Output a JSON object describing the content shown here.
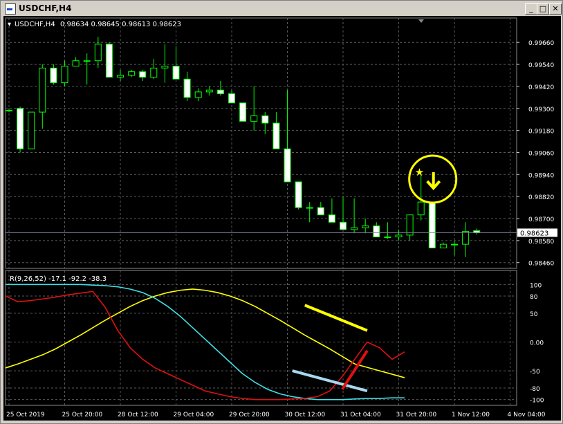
{
  "window": {
    "title": "USDCHF,H4",
    "icon": "chart-window-icon",
    "minimize_icon": "minimize-icon",
    "maximize_icon": "maximize-icon",
    "close_icon": "close-icon"
  },
  "colors": {
    "background": "#000000",
    "grid": "#5a5a5a",
    "axis_text": "#ffffff",
    "candle_stroke": "#00ff00",
    "bull_body": "#000000",
    "bear_body": "#ffffff",
    "price_line": "#7f7f9f",
    "yellow": "#ffff00",
    "cyan": "#40e0e8",
    "red": "#e01010",
    "light_blue": "#a8d8f0"
  },
  "chart_data": [
    {
      "type": "candlestick",
      "title": "USDCHF,H4",
      "ohlc_label": "0.98634 0.98645 0.98613 0.98623",
      "current_price": "0.98623",
      "yticks": [
        "0.99660",
        "0.99540",
        "0.99420",
        "0.99300",
        "0.99180",
        "0.99060",
        "0.98940",
        "0.98820",
        "0.98700",
        "0.98580",
        "0.98460"
      ],
      "ylim": [
        0.9844,
        0.9974
      ],
      "xticks": [
        {
          "i": 0,
          "label": "25 Oct 2019"
        },
        {
          "i": 5,
          "label": "25 Oct 20:00"
        },
        {
          "i": 10,
          "label": "28 Oct 12:00"
        },
        {
          "i": 15,
          "label": "29 Oct 04:00"
        },
        {
          "i": 20,
          "label": "29 Oct 20:00"
        },
        {
          "i": 25,
          "label": "30 Oct 12:00"
        },
        {
          "i": 30,
          "label": "31 Oct 04:00"
        },
        {
          "i": 35,
          "label": "31 Oct 20:00"
        },
        {
          "i": 40,
          "label": "1 Nov 12:00"
        },
        {
          "i": 45,
          "label": "4 Nov 04:00"
        }
      ],
      "candles": [
        [
          0.9929,
          0.993,
          0.9928,
          0.9929
        ],
        [
          0.993,
          0.9931,
          0.9906,
          0.9908
        ],
        [
          0.9908,
          0.9921,
          0.9908,
          0.9928
        ],
        [
          0.9928,
          0.9954,
          0.9919,
          0.9952
        ],
        [
          0.9952,
          0.9954,
          0.9943,
          0.9944
        ],
        [
          0.9944,
          0.9956,
          0.9942,
          0.9953
        ],
        [
          0.9953,
          0.9958,
          0.9953,
          0.9956
        ],
        [
          0.9956,
          0.996,
          0.9943,
          0.9956
        ],
        [
          0.9956,
          0.9969,
          0.9952,
          0.9965
        ],
        [
          0.9965,
          0.9966,
          0.9947,
          0.9947
        ],
        [
          0.9947,
          0.9951,
          0.9945,
          0.9948
        ],
        [
          0.9948,
          0.9951,
          0.9947,
          0.995
        ],
        [
          0.995,
          0.9951,
          0.9945,
          0.9947
        ],
        [
          0.9947,
          0.9957,
          0.9946,
          0.9952
        ],
        [
          0.9952,
          0.9965,
          0.9944,
          0.9953
        ],
        [
          0.9953,
          0.9964,
          0.9946,
          0.9946
        ],
        [
          0.9946,
          0.995,
          0.9934,
          0.9936
        ],
        [
          0.9936,
          0.9941,
          0.9934,
          0.9939
        ],
        [
          0.9939,
          0.9942,
          0.9937,
          0.994
        ],
        [
          0.994,
          0.9945,
          0.9937,
          0.9938
        ],
        [
          0.9938,
          0.994,
          0.9933,
          0.9933
        ],
        [
          0.9933,
          0.9933,
          0.9924,
          0.9923
        ],
        [
          0.9923,
          0.9942,
          0.9918,
          0.9926
        ],
        [
          0.9926,
          0.9928,
          0.9916,
          0.9922
        ],
        [
          0.9922,
          0.9928,
          0.9908,
          0.9908
        ],
        [
          0.9908,
          0.994,
          0.9892,
          0.989
        ],
        [
          0.989,
          0.989,
          0.9875,
          0.9876
        ],
        [
          0.9876,
          0.9879,
          0.9868,
          0.9876
        ],
        [
          0.9876,
          0.9879,
          0.9874,
          0.9872
        ],
        [
          0.9872,
          0.9881,
          0.9868,
          0.9868
        ],
        [
          0.9868,
          0.9882,
          0.9864,
          0.9864
        ],
        [
          0.9864,
          0.9881,
          0.9862,
          0.9865
        ],
        [
          0.9865,
          0.987,
          0.9862,
          0.9866
        ],
        [
          0.9866,
          0.9868,
          0.9861,
          0.986
        ],
        [
          0.986,
          0.9868,
          0.9859,
          0.986
        ],
        [
          0.986,
          0.9864,
          0.9858,
          0.9861
        ],
        [
          0.9861,
          0.9871,
          0.9858,
          0.9872
        ],
        [
          0.9872,
          0.9894,
          0.9869,
          0.9879
        ],
        [
          0.9879,
          0.9879,
          0.9854,
          0.9854
        ],
        [
          0.9854,
          0.9857,
          0.9854,
          0.9856
        ],
        [
          0.9856,
          0.9858,
          0.985,
          0.9856
        ],
        [
          0.9856,
          0.9868,
          0.9849,
          0.9863
        ],
        [
          0.98634,
          0.98645,
          0.98613,
          0.98623
        ]
      ],
      "annotation": {
        "type": "circle-with-star-and-arrow",
        "color": "#ffff00",
        "candle_index": 37
      }
    },
    {
      "type": "line",
      "indicator_label": "R(9,26,52) -17.1 -92.2 -38.3",
      "yticks": [
        "100",
        "80",
        "50",
        "0.00",
        "-50",
        "-80",
        "-100"
      ],
      "ylim": [
        -110,
        110
      ],
      "series": [
        {
          "color": "#ffff00",
          "values": [
            -45,
            -38,
            -30,
            -22,
            -12,
            0,
            12,
            25,
            38,
            50,
            62,
            72,
            80,
            86,
            90,
            92,
            90,
            86,
            80,
            72,
            62,
            50,
            38,
            25,
            12,
            0,
            -12,
            -25,
            -38,
            -44,
            -50,
            -56,
            -62
          ]
        },
        {
          "color": "#40e0e8",
          "values": [
            100,
            100,
            100,
            100,
            100,
            100,
            100,
            99,
            98,
            96,
            92,
            86,
            76,
            62,
            45,
            25,
            5,
            -15,
            -35,
            -55,
            -70,
            -82,
            -90,
            -95,
            -98,
            -100,
            -100,
            -100,
            -99,
            -98,
            -98,
            -97,
            -97
          ]
        },
        {
          "color": "#e01010",
          "values": [
            80,
            70,
            72,
            75,
            78,
            82,
            85,
            88,
            60,
            20,
            -10,
            -30,
            -45,
            -55,
            -65,
            -75,
            -85,
            -90,
            -95,
            -98,
            -100,
            -100,
            -100,
            -99,
            -98,
            -95,
            -85,
            -60,
            -30,
            0,
            -10,
            -30,
            -17.1
          ]
        }
      ],
      "trendlines": [
        {
          "color": "#ffff00",
          "from": [
            24,
            64
          ],
          "to": [
            29,
            20
          ]
        },
        {
          "color": "#a8d8f0",
          "from": [
            23,
            -50
          ],
          "to": [
            29,
            -85
          ]
        },
        {
          "color": "#e01010",
          "from": [
            27,
            -82
          ],
          "to": [
            29,
            -15
          ]
        }
      ]
    }
  ]
}
